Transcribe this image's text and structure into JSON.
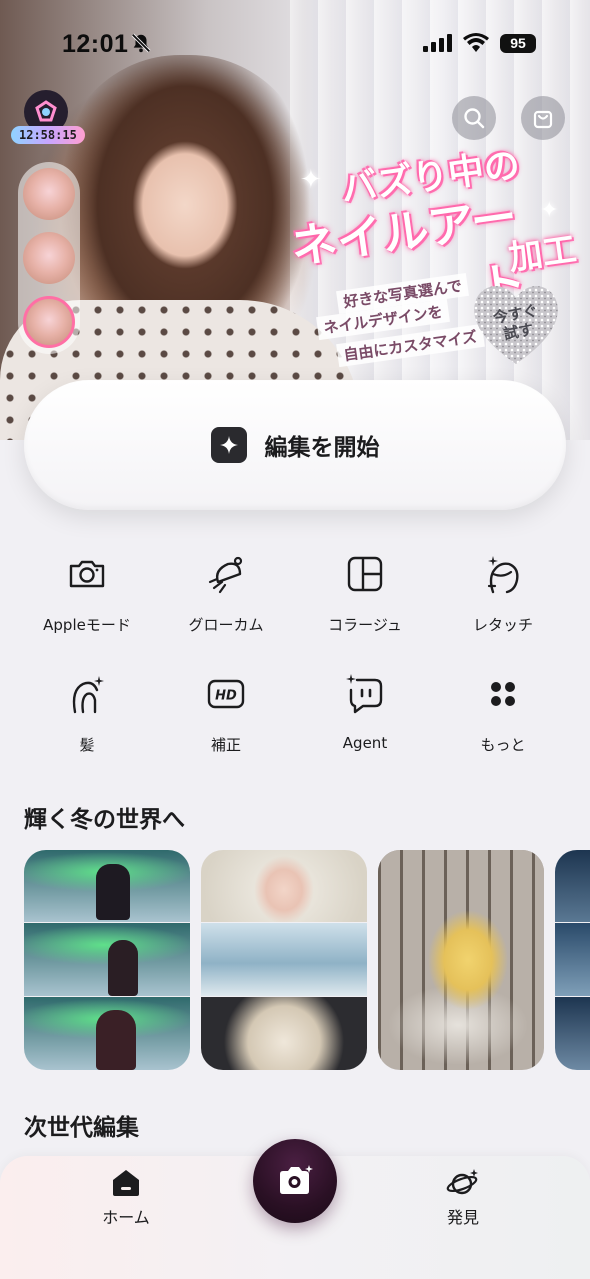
{
  "status_bar": {
    "time": "12:01",
    "battery": "95"
  },
  "hero": {
    "timer": "12:58:15",
    "headline_line1": "バズり中の",
    "headline_line2": "ネイルアート",
    "headline_line3": "加工",
    "sub_line1": "好きな写真選んで",
    "sub_line2": "ネイルデザインを",
    "sub_line3": "自由にカスタマイズ",
    "cta_line1": "今すぐ",
    "cta_line2": "試す"
  },
  "edit_button": {
    "label": "編集を開始"
  },
  "tools": [
    {
      "label": "Appleモード",
      "icon": "camera-icon"
    },
    {
      "label": "グローカム",
      "icon": "glow-cam-icon"
    },
    {
      "label": "コラージュ",
      "icon": "collage-icon"
    },
    {
      "label": "レタッチ",
      "icon": "retouch-face-icon"
    },
    {
      "label": "髪",
      "icon": "hair-icon"
    },
    {
      "label": "補正",
      "icon": "hd-icon"
    },
    {
      "label": "Agent",
      "icon": "agent-chat-icon"
    },
    {
      "label": "もっと",
      "icon": "more-grid-icon"
    }
  ],
  "sections": {
    "winter_title": "輝く冬の世界へ",
    "next_gen_title": "次世代編集"
  },
  "tabbar": {
    "home": "ホーム",
    "discover": "発見"
  },
  "colors": {
    "accent_pink": "#ff6fa5",
    "fab": "#2a1024"
  }
}
